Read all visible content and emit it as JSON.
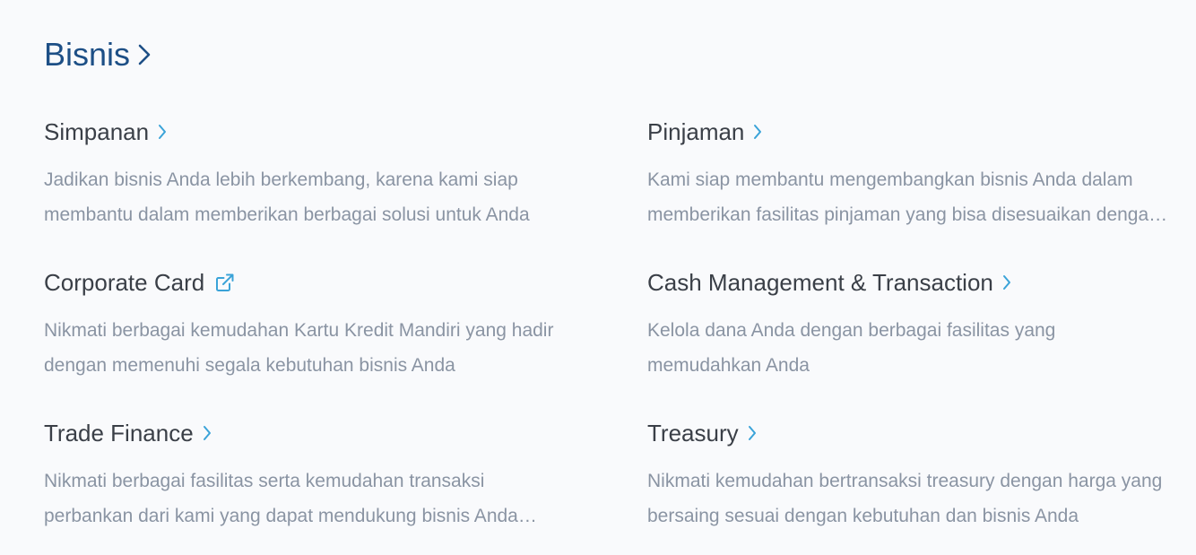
{
  "section": {
    "title": "Bisnis",
    "title_icon": "chevron-right-icon",
    "title_color": "#1d4f86",
    "accent_color": "#3aa3d8"
  },
  "cards": [
    {
      "title": "Simpanan",
      "icon": "chevron-right-icon",
      "desc_line1": "Jadikan bisnis Anda lebih berkembang, karena kami siap",
      "desc_line2": "membantu dalam memberikan berbagai solusi untuk Anda"
    },
    {
      "title": "Pinjaman",
      "icon": "chevron-right-icon",
      "desc_line1": "Kami siap membantu mengembangkan bisnis Anda dalam",
      "desc_line2": "memberikan fasilitas pinjaman yang bisa disesuaikan denga…"
    },
    {
      "title": "Corporate Card",
      "icon": "external-link-icon",
      "desc_line1": "Nikmati berbagai kemudahan Kartu Kredit Mandiri yang hadir",
      "desc_line2": "dengan memenuhi segala kebutuhan bisnis Anda"
    },
    {
      "title": "Cash Management & Transaction",
      "icon": "chevron-right-icon",
      "desc_line1": "Kelola dana Anda dengan berbagai fasilitas yang",
      "desc_line2": "memudahkan Anda"
    },
    {
      "title": "Trade Finance",
      "icon": "chevron-right-icon",
      "desc_line1": "Nikmati berbagai fasilitas serta kemudahan transaksi",
      "desc_line2": "perbankan dari kami yang dapat mendukung bisnis Anda…"
    },
    {
      "title": "Treasury",
      "icon": "chevron-right-icon",
      "desc_line1": "Nikmati kemudahan bertransaksi treasury dengan harga yang",
      "desc_line2": "bersaing sesuai dengan kebutuhan dan bisnis Anda"
    }
  ]
}
